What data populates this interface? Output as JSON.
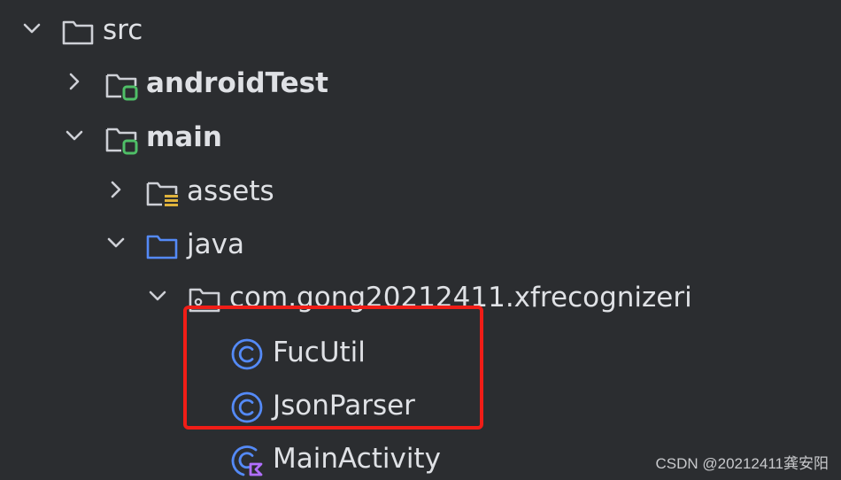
{
  "tree": {
    "src": {
      "label": "src",
      "expanded": true
    },
    "android_test": {
      "label": "androidTest",
      "expanded": false
    },
    "main": {
      "label": "main",
      "expanded": true
    },
    "assets": {
      "label": "assets",
      "expanded": false
    },
    "java": {
      "label": "java",
      "expanded": true
    },
    "package": {
      "label": "com.gong20212411.xfrecognizeri",
      "expanded": true
    },
    "classes": [
      {
        "label": "FucUtil",
        "icon": "class-icon"
      },
      {
        "label": "JsonParser",
        "icon": "class-icon"
      },
      {
        "label": "MainActivity",
        "icon": "kotlin-activity-icon"
      }
    ]
  },
  "watermark": "CSDN @20212411龚安阳",
  "colors": {
    "background": "#2b2d30",
    "text": "#dfe1e5",
    "folder_outline": "#ced0d6",
    "source_root_badge": "#4fbf67",
    "java_folder": "#548af7",
    "class_icon": "#548af7",
    "kotlin_badge": "#b16fff",
    "assets_badge": "#e0b33c",
    "highlight": "#f01d17"
  }
}
